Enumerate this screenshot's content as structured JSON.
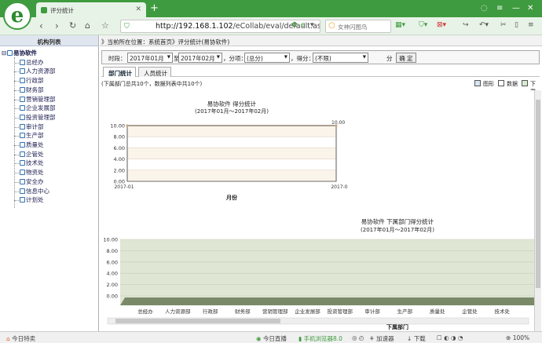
{
  "browser": {
    "tab_title": "评分统计",
    "new_tab": "+",
    "url_host": "http://192.168.1.102",
    "url_path": "/eCollab/eval/default.asp",
    "search_placeholder": "女神闪图鸟",
    "logo_letter": "e"
  },
  "sidebar": {
    "title": "机构列表",
    "root": "易协软件",
    "items": [
      "总经办",
      "人力资源部",
      "行政部",
      "财务部",
      "营销管理部",
      "企业发展部",
      "投资管理部",
      "审计部",
      "生产部",
      "质量处",
      "企管处",
      "技术处",
      "物资处",
      "安全办",
      "信息中心",
      "计划处"
    ]
  },
  "breadcrumb": {
    "prefix": "》当前所在位置：",
    "home": "系统首页",
    "sep": "》",
    "current": "评分统计(易协软件)"
  },
  "filter": {
    "period_label": "时段：",
    "from": "2017年01月",
    "to_label": "至",
    "to": "2017年02月",
    "category_label": "，分项：",
    "category": "(总分)",
    "score_label": "，得分：",
    "score": "(不限)",
    "unit": "分",
    "confirm": "确 定"
  },
  "subtabs": [
    "部门统计",
    "人员统计"
  ],
  "summary": "(下属部门总共10个，数据列表中共10个)",
  "view_options": [
    "图形",
    "数据",
    "下载"
  ],
  "chart_data": [
    {
      "type": "line",
      "title": "易协软件 得分统计",
      "subtitle": "(2017年01月～2017年02月)",
      "xlabel": "月份",
      "ylabel": "",
      "categories": [
        "2017-01",
        "2017-0"
      ],
      "values": [
        10.0,
        10.0
      ],
      "data_labels": [
        "",
        "10.00"
      ],
      "ylim": [
        0,
        10
      ],
      "yticks": [
        "10.00",
        "8.00",
        "6.00",
        "4.00",
        "2.00",
        "0.00"
      ],
      "grid": true
    },
    {
      "type": "bar",
      "title": "易协软件 下属部门得分统计",
      "subtitle": "(2017年01月～2017年02月)",
      "xlabel": "下属部门",
      "ylabel": "",
      "categories": [
        "总经办",
        "人力资源部",
        "行政部",
        "财务部",
        "营销管理部",
        "企业发展部",
        "投资管理部",
        "审计部",
        "生产部",
        "质量处",
        "企管处",
        "技术处"
      ],
      "values": [
        0,
        0,
        0,
        0,
        0,
        0,
        0,
        0,
        0,
        0,
        0,
        0
      ],
      "ylim": [
        0,
        10
      ],
      "yticks": [
        "10.00",
        "8.00",
        "6.00",
        "4.00",
        "2.00",
        "0.00"
      ],
      "grid": true,
      "colors": {
        "plot_bg": "#dfe6d3",
        "floor": "#7a8a68"
      }
    }
  ],
  "statusbar": {
    "left": "今日特卖",
    "live": "今日直播",
    "phone": "手机浏览器8.0",
    "accel": "加速器",
    "download": "下载",
    "zoom": "100%"
  },
  "colors": {
    "brand": "#3f9b3f",
    "line": "#7a6a5a"
  }
}
